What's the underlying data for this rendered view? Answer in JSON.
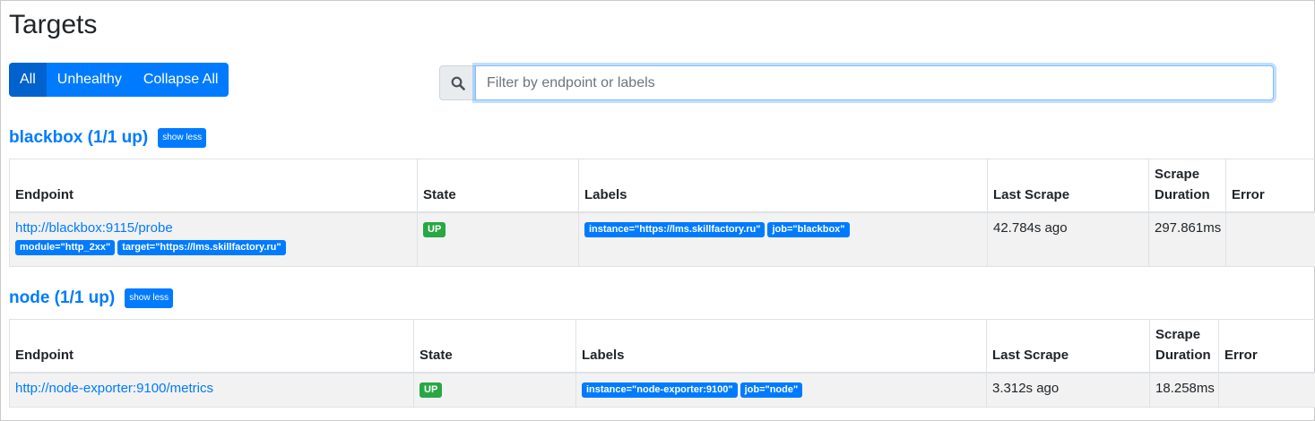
{
  "page": {
    "title": "Targets"
  },
  "filters": {
    "all_label": "All",
    "unhealthy_label": "Unhealthy",
    "collapse_label": "Collapse All"
  },
  "search": {
    "placeholder": "Filter by endpoint or labels",
    "value": ""
  },
  "columns": {
    "endpoint": "Endpoint",
    "state": "State",
    "labels": "Labels",
    "last_scrape": "Last Scrape",
    "scrape_duration_1": "Scrape",
    "scrape_duration_2": "Duration",
    "error": "Error"
  },
  "jobs": [
    {
      "title": "blackbox (1/1 up)",
      "toggle_label": "show less",
      "targets": [
        {
          "endpoint": "http://blackbox:9115/probe",
          "endpoint_labels": [
            "module=\"http_2xx\"",
            "target=\"https://lms.skillfactory.ru\""
          ],
          "state": "UP",
          "labels": [
            "instance=\"https://lms.skillfactory.ru\"",
            "job=\"blackbox\""
          ],
          "last_scrape": "42.784s ago",
          "scrape_duration": "297.861ms",
          "error": ""
        }
      ]
    },
    {
      "title": "node (1/1 up)",
      "toggle_label": "show less",
      "targets": [
        {
          "endpoint": "http://node-exporter:9100/metrics",
          "endpoint_labels": [],
          "state": "UP",
          "labels": [
            "instance=\"node-exporter:9100\"",
            "job=\"node\""
          ],
          "last_scrape": "3.312s ago",
          "scrape_duration": "18.258ms",
          "error": ""
        }
      ]
    }
  ],
  "colors": {
    "primary": "#007bff",
    "success": "#28a745",
    "row_bg": "#f2f2f2"
  }
}
